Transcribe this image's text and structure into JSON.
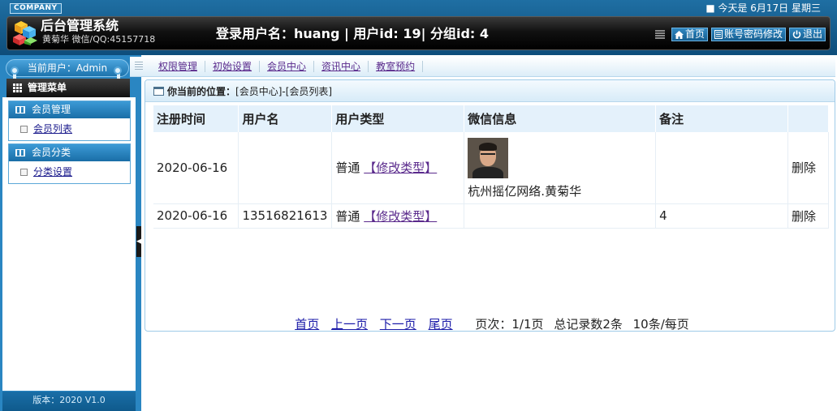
{
  "header": {
    "company": "COMPANY",
    "today": "■ 今天是 6月17日  星期三",
    "title": "后台管理系统",
    "subtitle": "黄菊华  微信/QQ:45157718",
    "login_info": "登录用户名：huang | 用户id: 19| 分组id: 4",
    "actions": [
      {
        "label": "首页",
        "icon": "home-icon"
      },
      {
        "label": "账号密码修改",
        "icon": "document-icon"
      },
      {
        "label": "退出",
        "icon": "power-icon"
      }
    ]
  },
  "sidebar": {
    "current_user": "当前用户：Admin",
    "menu_title": "管理菜单",
    "groups": [
      {
        "title": "会员管理",
        "items": [
          "会员列表"
        ]
      },
      {
        "title": "会员分类",
        "items": [
          "分类设置"
        ]
      }
    ],
    "version": "版本：2020 V1.0"
  },
  "tabs": [
    "权限管理",
    "初始设置",
    "会员中心",
    "资讯中心",
    "教室预约"
  ],
  "breadcrumb": {
    "label": "你当前的位置：",
    "path": "[会员中心]-[会员列表]"
  },
  "table": {
    "headers": [
      "注册时间",
      "用户名",
      "用户类型",
      "微信信息",
      "备注",
      ""
    ],
    "rows": [
      {
        "date": "2020-06-16",
        "username": "",
        "type": "普通",
        "type_link": "【修改类型】",
        "wechat_name": "杭州摇亿网络.黄菊华",
        "has_avatar": true,
        "note": "",
        "action": "删除"
      },
      {
        "date": "2020-06-16",
        "username": "13516821613",
        "type": "普通",
        "type_link": "【修改类型】",
        "wechat_name": "",
        "has_avatar": false,
        "note": "4",
        "action": "删除"
      }
    ]
  },
  "pager": {
    "first": "首页",
    "prev": "上一页",
    "next": "下一页",
    "last": "尾页",
    "page_info": "页次：1/1页",
    "total": "总记录数2条",
    "per_page": "10条/每页"
  },
  "colors": {
    "frame_blue": "#2a86c2",
    "header_black": "#111111",
    "table_head": "#e4f1fb"
  }
}
